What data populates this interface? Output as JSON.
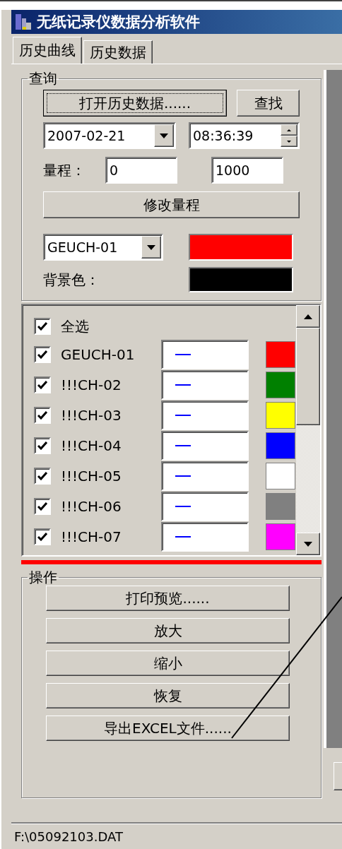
{
  "window": {
    "title": "无纸记录仪数据分析软件"
  },
  "tabs": [
    {
      "label": "历史曲线",
      "selected": true
    },
    {
      "label": "历史数据",
      "selected": false
    }
  ],
  "query": {
    "title": "查询",
    "open_button": "打开历史数据......",
    "find_button": "查找",
    "date": "2007-02-21",
    "time": "08:36:39",
    "range_label": "量程：",
    "range_min": "0",
    "range_max": "1000",
    "modify_button": "修改量程",
    "channel_select": "GEUCH-01",
    "background_label": "背景色："
  },
  "channel_list": {
    "select_all": {
      "label": "全选",
      "checked": true
    },
    "channels": [
      {
        "name": "GEUCH-01",
        "checked": true,
        "color": "#ff0000"
      },
      {
        "name": "!!!CH-02",
        "checked": true,
        "color": "#008000"
      },
      {
        "name": "!!!CH-03",
        "checked": true,
        "color": "#ffff00"
      },
      {
        "name": "!!!CH-04",
        "checked": true,
        "color": "#0000ff"
      },
      {
        "name": "!!!CH-05",
        "checked": true,
        "color": "#ffffff"
      },
      {
        "name": "!!!CH-06",
        "checked": true,
        "color": "#808080"
      },
      {
        "name": "!!!CH-07",
        "checked": true,
        "color": "#ff00ff"
      }
    ]
  },
  "operations": {
    "title": "操作",
    "buttons": [
      "打印预览......",
      "放大",
      "缩小",
      "恢复",
      "导出EXCEL文件......"
    ]
  },
  "status_bar": {
    "text": "F:\\05092103.DAT"
  }
}
